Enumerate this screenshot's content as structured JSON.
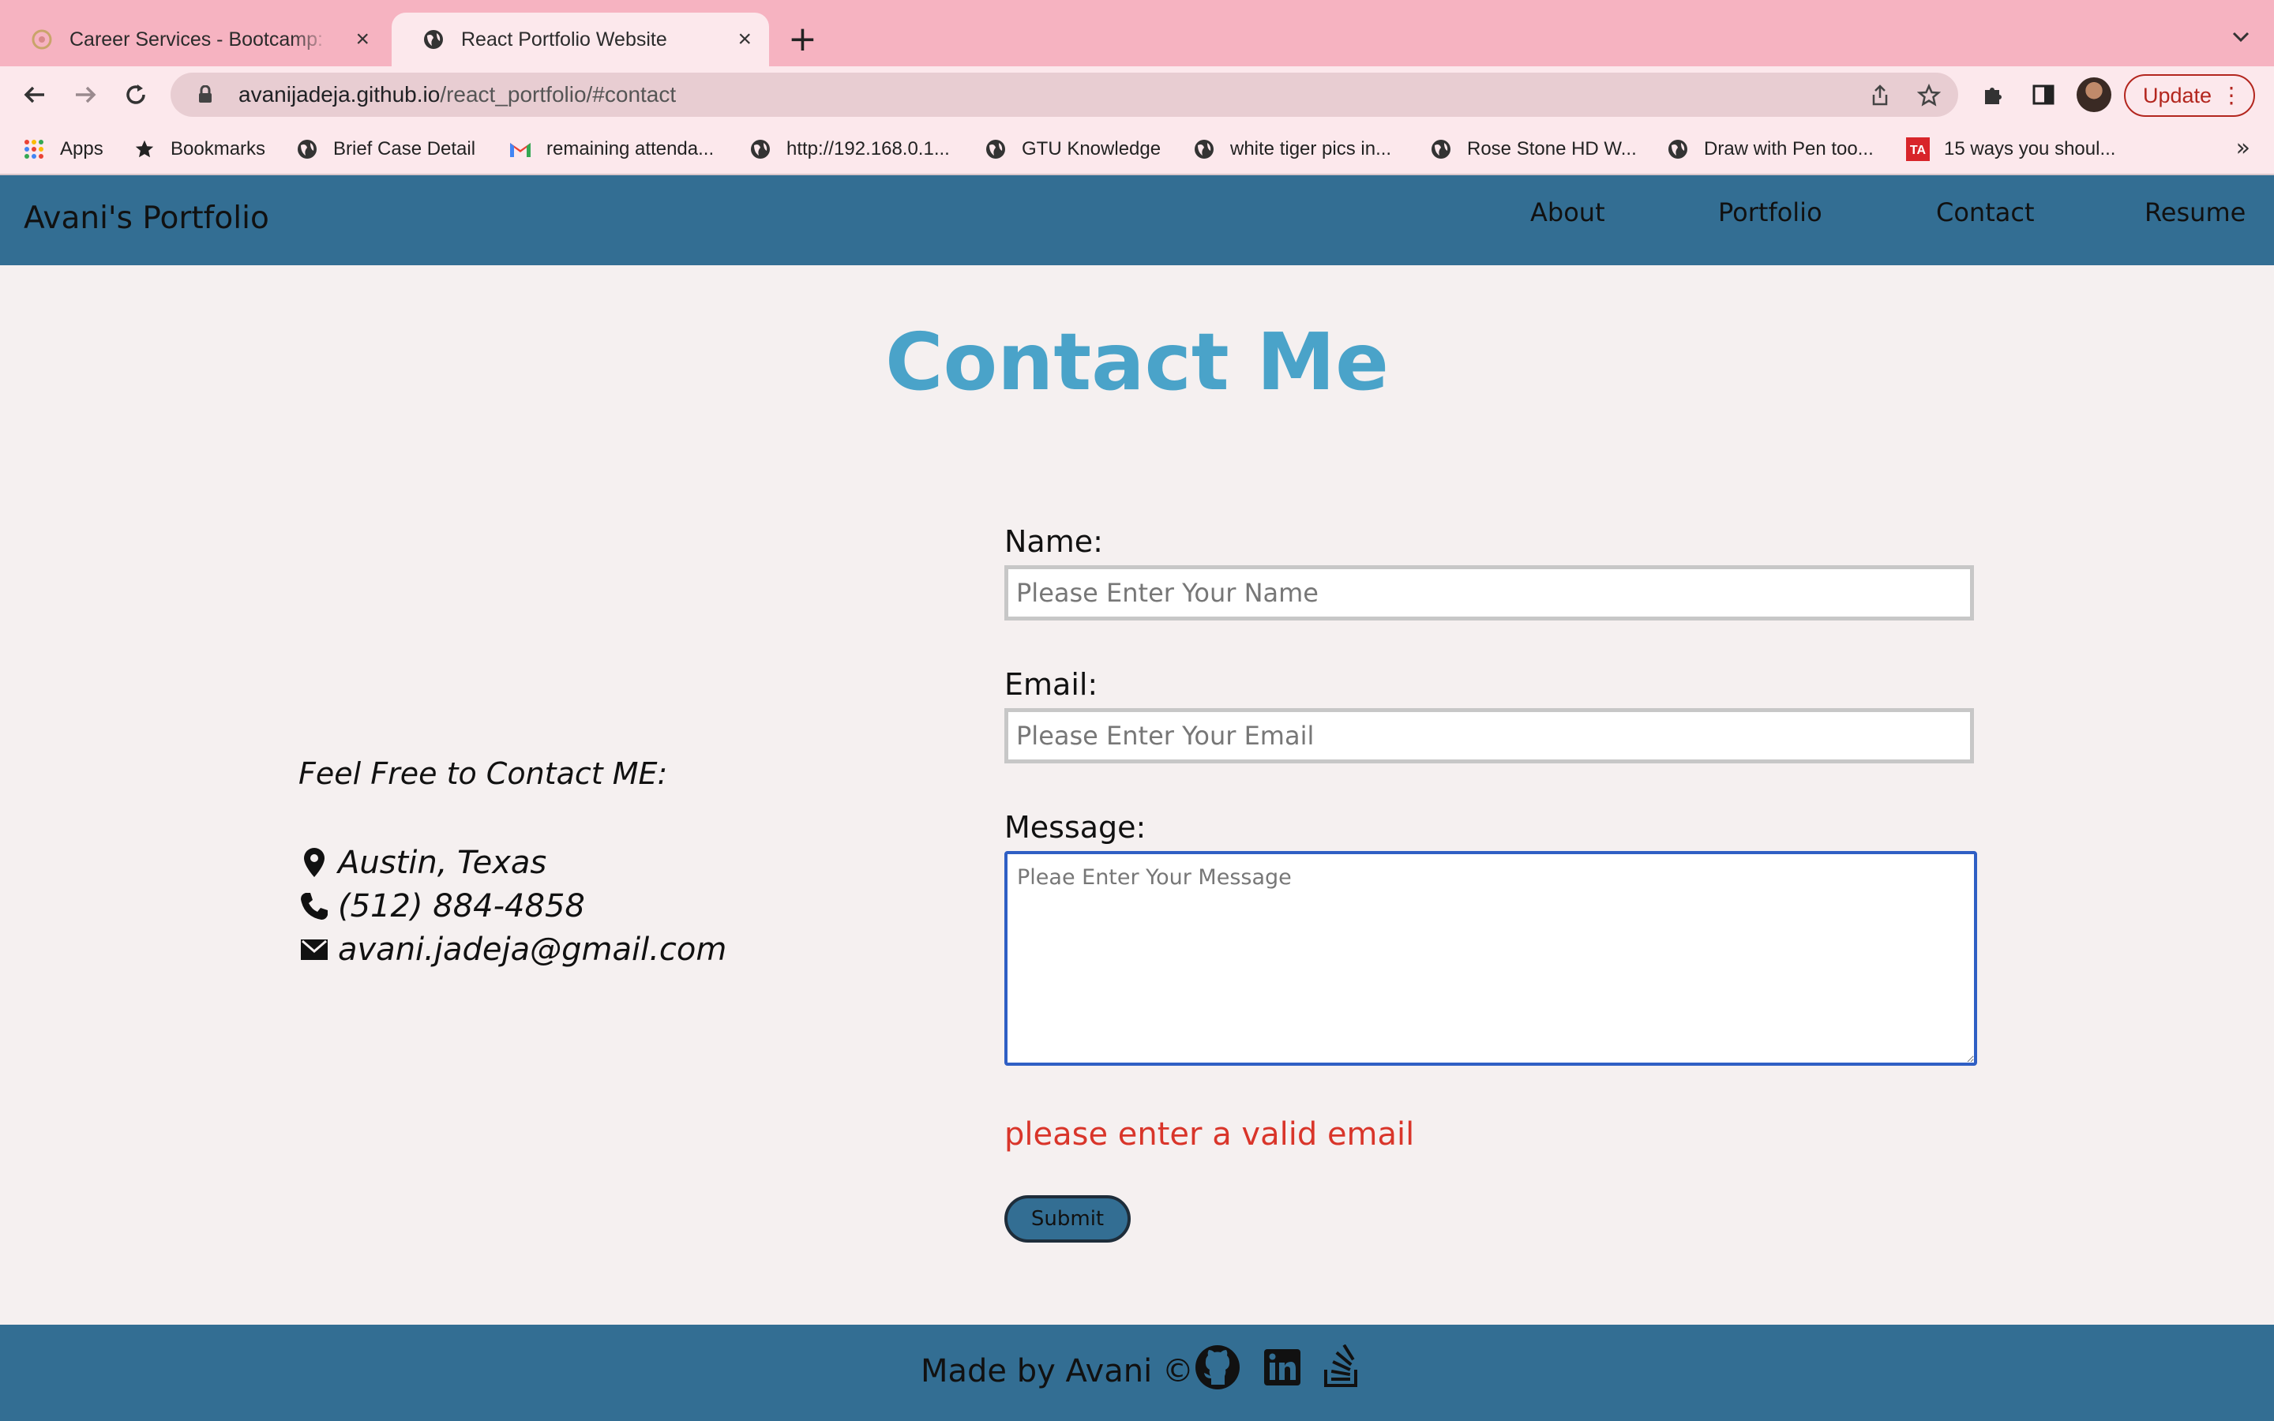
{
  "browser": {
    "tabs": [
      {
        "title": "Career Services - Bootcamp: U",
        "icon": "career-services-favicon",
        "active": false
      },
      {
        "title": "React Portfolio Website",
        "icon": "globe-icon",
        "active": true
      }
    ],
    "new_tab_symbol": "+",
    "tab_menu_symbol": "⌄",
    "address": {
      "host": "avanijadeja.github.io",
      "path": "/react_portfolio/#contact"
    },
    "update_label": "Update",
    "bookmarks": [
      {
        "label": "Apps",
        "icon": "apps-grid-icon"
      },
      {
        "label": "Bookmarks",
        "icon": "star-icon"
      },
      {
        "label": "Brief Case Detail",
        "icon": "globe-icon"
      },
      {
        "label": "remaining attenda...",
        "icon": "gmail-icon"
      },
      {
        "label": "http://192.168.0.1...",
        "icon": "globe-icon"
      },
      {
        "label": "GTU Knowledge",
        "icon": "globe-icon"
      },
      {
        "label": "white tiger pics in...",
        "icon": "globe-icon"
      },
      {
        "label": "Rose Stone HD W...",
        "icon": "globe-icon"
      },
      {
        "label": "Draw with Pen too...",
        "icon": "globe-icon"
      },
      {
        "label": "15 ways you shoul...",
        "icon": "ta-icon"
      }
    ],
    "bookmarks_overflow": "»"
  },
  "site": {
    "brand": "Avani's Portfolio",
    "nav": [
      "About",
      "Portfolio",
      "Contact",
      "Resume"
    ],
    "colors": {
      "header": "#336e93",
      "title": "#4aa3c9",
      "error": "#d9352a",
      "background": "#f5f0f0"
    }
  },
  "contact": {
    "title": "Contact Me",
    "intro": "Feel Free to Contact ME:",
    "location": "Austin, Texas",
    "phone": "(512) 884-4858",
    "email": "avani.jadeja@gmail.com"
  },
  "form": {
    "name_label": "Name:",
    "name_placeholder": "Please Enter Your Name",
    "name_value": "",
    "email_label": "Email:",
    "email_placeholder": "Please Enter Your Email",
    "email_value": "",
    "message_label": "Message:",
    "message_placeholder": "Pleae Enter Your Message",
    "message_value": "",
    "error": "please enter a valid email",
    "submit_label": "Submit"
  },
  "footer": {
    "made_by": "Made by Avani ©",
    "social": [
      "github-icon",
      "linkedin-icon",
      "stackoverflow-icon"
    ]
  }
}
